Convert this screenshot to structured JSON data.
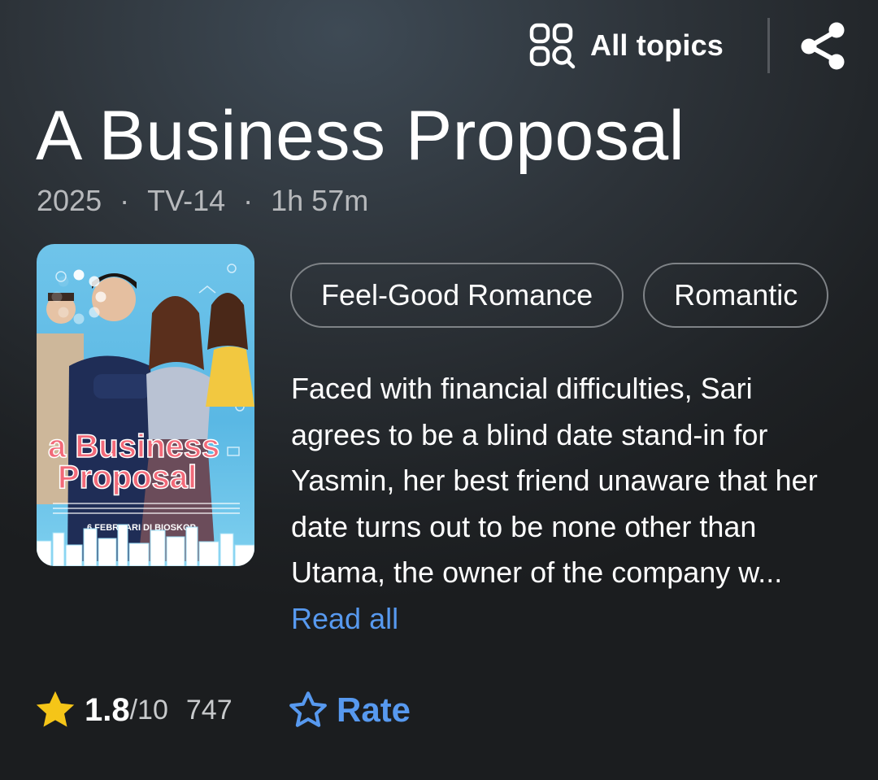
{
  "header": {
    "all_topics_label": "All topics",
    "topics_icon": "grid-search-icon",
    "share_icon": "share-icon"
  },
  "title": {
    "text": "A Business Proposal",
    "year": "2025",
    "rating_label": "TV-14",
    "runtime": "1h 57m",
    "separator": "·"
  },
  "poster": {
    "title_line1": "a Business",
    "title_line2": "Proposal",
    "release_text": "6 FEBRUARI DI BIOSKOP"
  },
  "genres": [
    "Feel-Good Romance",
    "Romantic"
  ],
  "plot": {
    "text": "Faced with financial difficulties, Sari agrees to be a blind date stand-in for Yasmin, her best friend unaware that her date turns out to be none other than Utama, the owner of the company w...",
    "read_all_label": "Read all"
  },
  "rating": {
    "score": "1.8",
    "max": "/10",
    "votes": "747",
    "rate_label": "Rate"
  },
  "colors": {
    "accent_blue": "#5799ef",
    "star_yellow": "#f5c518",
    "text_secondary": "#b7b9bc"
  }
}
